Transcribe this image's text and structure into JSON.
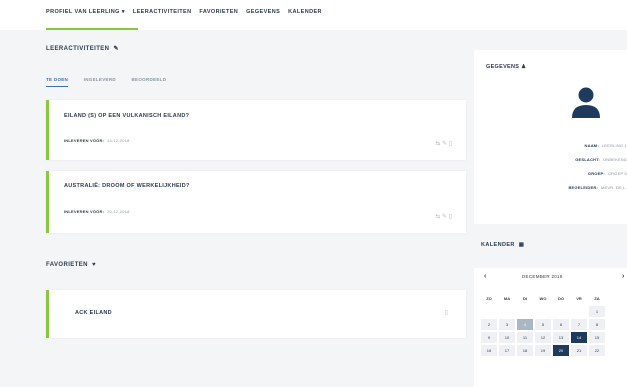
{
  "nav": {
    "items": [
      "PROFIEL VAN LEERLING ▾",
      "LEERACTIVITEITEN",
      "FAVORIETEN",
      "GEGEVENS",
      "KALENDER"
    ]
  },
  "leeractiviteiten": {
    "title": "LEERACTIVITEITEN",
    "tabs": [
      "TE DOEN",
      "INGELEVERD",
      "BEOORDEELD"
    ],
    "cards": [
      {
        "title": "EILAND (S) OP EEN VULKANISCH EILAND?",
        "due_label": "INLEVEREN VÓÓR:",
        "due_date": "14-12-2018"
      },
      {
        "title": "AUSTRALIË: DROOM OF WERKELIJKHEID?",
        "due_label": "INLEVEREN VÓÓR:",
        "due_date": "20-12-2018"
      }
    ]
  },
  "favorieten": {
    "title": "FAVORIETEN",
    "items": [
      {
        "title": "ACK EILAND"
      }
    ]
  },
  "gegevens": {
    "title": "GEGEVENS",
    "rows": [
      {
        "label": "NAAM:",
        "value": "LEERLING 1"
      },
      {
        "label": "GESLACHT:",
        "value": "ONBEKEND"
      },
      {
        "label": "GROEP:",
        "value": "GROEP 5"
      },
      {
        "label": "BEGELEIDER:",
        "value": "MEVR. DE L."
      }
    ]
  },
  "kalender": {
    "title": "KALENDER",
    "month": "DECEMBER 2018",
    "prev": "‹",
    "next": "›",
    "weekdays": [
      "ZO",
      "MA",
      "DI",
      "WO",
      "DO",
      "VR",
      "ZA"
    ],
    "rows": [
      [
        "",
        "",
        "",
        "",
        "",
        "",
        "1"
      ],
      [
        "2",
        "3",
        "4",
        "5",
        "6",
        "7",
        "8"
      ],
      [
        "9",
        "10",
        "11",
        "12",
        "13",
        "14",
        "15"
      ],
      [
        "16",
        "17",
        "18",
        "19",
        "20",
        "21",
        "22"
      ]
    ],
    "highlight_day": "4",
    "selected_days": [
      "14",
      "20"
    ]
  },
  "icons": {
    "accent": "#8cc63f",
    "link": "#3b6fb6",
    "dark": "#1f3a5f",
    "pencil": "pencil-icon",
    "heart": "heart-icon",
    "user": "user-icon",
    "calendar": "calendar-icon"
  }
}
